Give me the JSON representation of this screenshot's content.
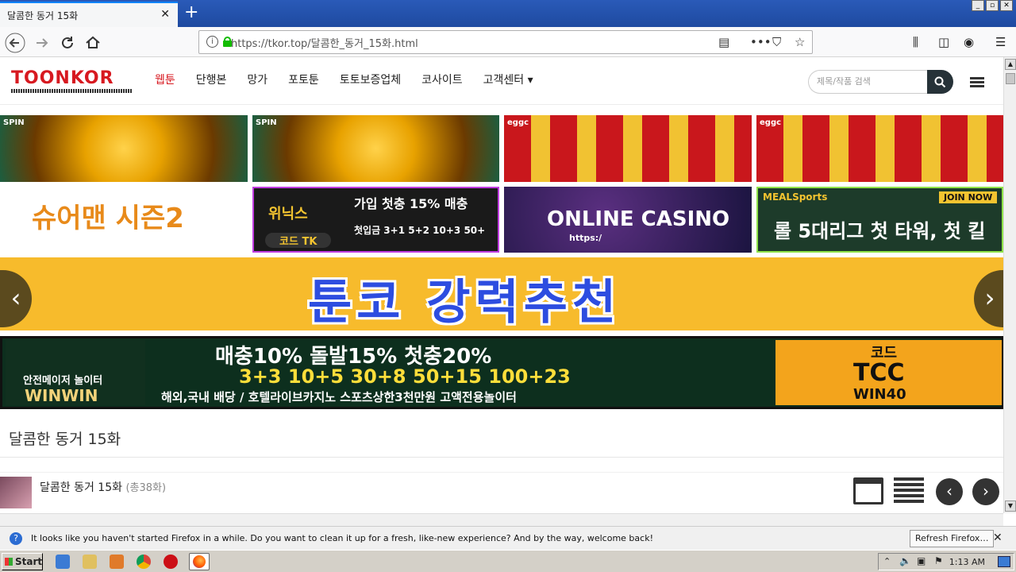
{
  "browser": {
    "tab_title": "달콤한 동거 15화",
    "tab_close": "✕",
    "new_tab": "+",
    "url": "https://tkor.top/달콤한_동거_15화.html",
    "window_controls": [
      "_",
      "▫",
      "✕"
    ]
  },
  "site": {
    "logo": "TOONKOR",
    "nav": [
      "웹툰",
      "단행본",
      "망가",
      "포토툰",
      "토토보증업체",
      "코사이트",
      "고객센터"
    ],
    "nav_active": "웹툰",
    "nav_dropdown_glyph": "▾",
    "search_placeholder": "제목/작품 검색"
  },
  "banners": {
    "slot1_tag": "SPIN",
    "slot2_tag": "SPIN",
    "eggc1_tag": "eggc",
    "eggc2_tag": "eggc",
    "shuai_text": "슈어맨 시즌2",
    "winix_line1": "가입 첫충 15% 매충",
    "winix_line2": "첫입금 3+1 5+2 10+3 50+",
    "winix_brand": "위닉스",
    "winix_code": "코드 TK",
    "casino_text": "ONLINE CASINO",
    "casino_sub": "https:/",
    "meal_brand": "MEALSports",
    "meal_join": "JOIN NOW",
    "meal_text": "롤 5대리그  첫 타워, 첫 킬",
    "hero_text": "툰코 강력추천",
    "winwin_left_sub": "안전메이저 놀이터",
    "winwin_left_brand": "WINWIN",
    "winwin_line1": "매충10% 돌발15% 첫충20%",
    "winwin_line2": "3+3 10+5 30+8 50+15 100+23",
    "winwin_line3": "해외,국내 배당 / 호텔라이브카지노 스포츠상한3천만원 고액전용놀이터",
    "winwin_code_label": "코드",
    "winwin_code": "TCC",
    "winwin_code2": "WIN40"
  },
  "content": {
    "page_title": "달콤한 동거 15화",
    "episode_title": "달콤한 동거 15화",
    "episode_count": "(총38화)"
  },
  "notification": {
    "text": "It looks like you haven't started Firefox in a while. Do you want to clean it up for a fresh, like-new experience? And by the way, welcome back!",
    "button": "Refresh Firefox…"
  },
  "taskbar": {
    "start": "Start",
    "clock": "1:13 AM"
  },
  "colors": {
    "brand_red": "#d71920",
    "hero_bg": "#f7bb2c",
    "hero_text": "#2d4de0"
  }
}
